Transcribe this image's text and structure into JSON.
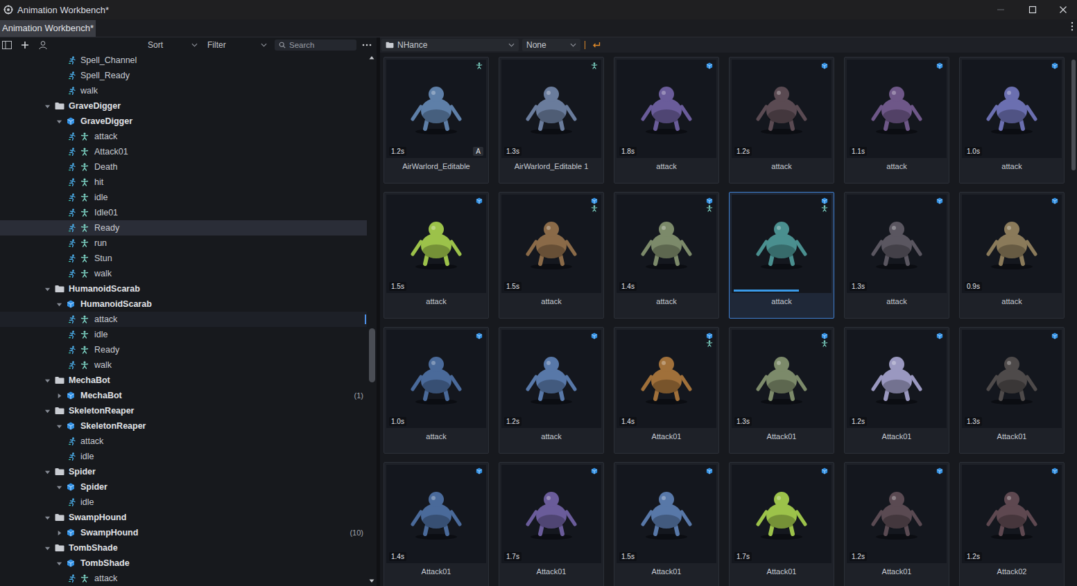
{
  "window": {
    "title": "Animation Workbench*"
  },
  "tabs": [
    {
      "label": "Animation Workbench*",
      "selected": true
    }
  ],
  "left_toolbar": {
    "sort": "Sort",
    "filter": "Filter",
    "search_placeholder": "Search"
  },
  "tree": [
    {
      "kind": "anim",
      "label": "Spell_Channel",
      "skeleton": false,
      "selected": false,
      "hovered": false
    },
    {
      "kind": "anim",
      "label": "Spell_Ready",
      "skeleton": false,
      "selected": false,
      "hovered": false
    },
    {
      "kind": "anim",
      "label": "walk",
      "skeleton": false,
      "selected": false,
      "hovered": false
    },
    {
      "kind": "folder",
      "label": "GraveDigger",
      "expanded": true,
      "selected": false,
      "hovered": false
    },
    {
      "kind": "model",
      "label": "GraveDigger",
      "expanded": true,
      "selected": false,
      "hovered": false
    },
    {
      "kind": "anim",
      "label": "attack",
      "skeleton": true,
      "selected": false,
      "hovered": false
    },
    {
      "kind": "anim",
      "label": "Attack01",
      "skeleton": true,
      "selected": false,
      "hovered": false
    },
    {
      "kind": "anim",
      "label": "Death",
      "skeleton": true,
      "selected": false,
      "hovered": false
    },
    {
      "kind": "anim",
      "label": "hit",
      "skeleton": true,
      "selected": false,
      "hovered": false
    },
    {
      "kind": "anim",
      "label": "idle",
      "skeleton": true,
      "selected": false,
      "hovered": false
    },
    {
      "kind": "anim",
      "label": "Idle01",
      "skeleton": true,
      "selected": false,
      "hovered": false
    },
    {
      "kind": "anim",
      "label": "Ready",
      "skeleton": true,
      "selected": true,
      "hovered": false
    },
    {
      "kind": "anim",
      "label": "run",
      "skeleton": true,
      "selected": false,
      "hovered": false
    },
    {
      "kind": "anim",
      "label": "Stun",
      "skeleton": true,
      "selected": false,
      "hovered": false
    },
    {
      "kind": "anim",
      "label": "walk",
      "skeleton": true,
      "selected": false,
      "hovered": false
    },
    {
      "kind": "folder",
      "label": "HumanoidScarab",
      "expanded": true,
      "selected": false,
      "hovered": false
    },
    {
      "kind": "model",
      "label": "HumanoidScarab",
      "expanded": true,
      "selected": false,
      "hovered": false
    },
    {
      "kind": "anim",
      "label": "attack",
      "skeleton": true,
      "selected": false,
      "hovered": true
    },
    {
      "kind": "anim",
      "label": "idle",
      "skeleton": true,
      "selected": false,
      "hovered": false
    },
    {
      "kind": "anim",
      "label": "Ready",
      "skeleton": true,
      "selected": false,
      "hovered": false
    },
    {
      "kind": "anim",
      "label": "walk",
      "skeleton": true,
      "selected": false,
      "hovered": false
    },
    {
      "kind": "folder",
      "label": "MechaBot",
      "expanded": true,
      "selected": false,
      "hovered": false
    },
    {
      "kind": "model",
      "label": "MechaBot",
      "expanded": false,
      "count": "(1)",
      "selected": false,
      "hovered": false
    },
    {
      "kind": "folder",
      "label": "SkeletonReaper",
      "expanded": true,
      "selected": false,
      "hovered": false
    },
    {
      "kind": "model",
      "label": "SkeletonReaper",
      "expanded": true,
      "selected": false,
      "hovered": false
    },
    {
      "kind": "anim",
      "label": "attack",
      "skeleton": false,
      "selected": false,
      "hovered": false
    },
    {
      "kind": "anim",
      "label": "idle",
      "skeleton": false,
      "selected": false,
      "hovered": false
    },
    {
      "kind": "folder",
      "label": "Spider",
      "expanded": true,
      "selected": false,
      "hovered": false
    },
    {
      "kind": "model",
      "label": "Spider",
      "expanded": true,
      "selected": false,
      "hovered": false
    },
    {
      "kind": "anim",
      "label": "idle",
      "skeleton": false,
      "selected": false,
      "hovered": false
    },
    {
      "kind": "folder",
      "label": "SwampHound",
      "expanded": true,
      "selected": false,
      "hovered": false
    },
    {
      "kind": "model",
      "label": "SwampHound",
      "expanded": false,
      "count": "(10)",
      "selected": false,
      "hovered": false
    },
    {
      "kind": "folder",
      "label": "TombShade",
      "expanded": true,
      "selected": false,
      "hovered": false
    },
    {
      "kind": "model",
      "label": "TombShade",
      "expanded": true,
      "selected": false,
      "hovered": false
    },
    {
      "kind": "anim",
      "label": "attack",
      "skeleton": true,
      "selected": false,
      "hovered": false
    }
  ],
  "browser": {
    "folder": "NHance",
    "filter": "None"
  },
  "cards": [
    {
      "name": "AirWarlord_Editable",
      "duration": "1.2s",
      "model": false,
      "skeleton": true,
      "badge": "A",
      "selected": false,
      "color": "#5e7fa8"
    },
    {
      "name": "AirWarlord_Editable 1",
      "duration": "1.3s",
      "model": false,
      "skeleton": true,
      "selected": false,
      "color": "#6a7c9c"
    },
    {
      "name": "attack",
      "duration": "1.8s",
      "model": true,
      "skeleton": false,
      "selected": false,
      "color": "#6a5c9a"
    },
    {
      "name": "attack",
      "duration": "1.2s",
      "model": true,
      "skeleton": false,
      "selected": false,
      "color": "#5a4a52"
    },
    {
      "name": "attack",
      "duration": "1.1s",
      "model": true,
      "skeleton": false,
      "selected": false,
      "color": "#6e5788"
    },
    {
      "name": "attack",
      "duration": "1.0s",
      "model": true,
      "skeleton": false,
      "selected": false,
      "color": "#6b6fb0"
    },
    {
      "name": "attack",
      "duration": "1.5s",
      "model": true,
      "skeleton": false,
      "selected": false,
      "color": "#9cc24a"
    },
    {
      "name": "attack",
      "duration": "1.5s",
      "model": true,
      "skeleton": true,
      "selected": false,
      "color": "#8a6a48"
    },
    {
      "name": "attack",
      "duration": "1.4s",
      "model": true,
      "skeleton": true,
      "selected": false,
      "color": "#7c8a6a"
    },
    {
      "name": "attack",
      "model": true,
      "skeleton": true,
      "selected": true,
      "progress": 0.68,
      "color": "#4a8f8f"
    },
    {
      "name": "attack",
      "duration": "1.3s",
      "model": true,
      "skeleton": false,
      "selected": false,
      "color": "#5a5660"
    },
    {
      "name": "attack",
      "duration": "0.9s",
      "model": true,
      "skeleton": false,
      "selected": false,
      "color": "#8a7a5a"
    },
    {
      "name": "attack",
      "duration": "1.0s",
      "model": true,
      "skeleton": false,
      "selected": false,
      "color": "#4a6a9a"
    },
    {
      "name": "attack",
      "duration": "1.2s",
      "model": true,
      "skeleton": false,
      "selected": false,
      "color": "#5878a8"
    },
    {
      "name": "Attack01",
      "duration": "1.4s",
      "model": true,
      "skeleton": true,
      "selected": false,
      "color": "#a0703a"
    },
    {
      "name": "Attack01",
      "duration": "1.3s",
      "model": true,
      "skeleton": true,
      "selected": false,
      "color": "#7c8a6a"
    },
    {
      "name": "Attack01",
      "duration": "1.2s",
      "model": true,
      "skeleton": false,
      "selected": false,
      "color": "#9a98c0"
    },
    {
      "name": "Attack01",
      "duration": "1.3s",
      "model": true,
      "skeleton": false,
      "selected": false,
      "color": "#4e4a4a"
    },
    {
      "name": "Attack01",
      "duration": "1.4s",
      "model": true,
      "skeleton": false,
      "selected": false,
      "color": "#4a6a9a"
    },
    {
      "name": "Attack01",
      "duration": "1.7s",
      "model": true,
      "skeleton": false,
      "selected": false,
      "color": "#6a5c9a"
    },
    {
      "name": "Attack01",
      "duration": "1.5s",
      "model": true,
      "skeleton": false,
      "selected": false,
      "color": "#5878a8"
    },
    {
      "name": "Attack01",
      "duration": "1.7s",
      "model": true,
      "skeleton": false,
      "selected": false,
      "color": "#9cc24a"
    },
    {
      "name": "Attack01",
      "duration": "1.2s",
      "model": true,
      "skeleton": false,
      "selected": false,
      "color": "#5a4a52"
    },
    {
      "name": "Attack02",
      "duration": "1.2s",
      "model": true,
      "skeleton": false,
      "selected": false,
      "color": "#5e4850"
    }
  ]
}
